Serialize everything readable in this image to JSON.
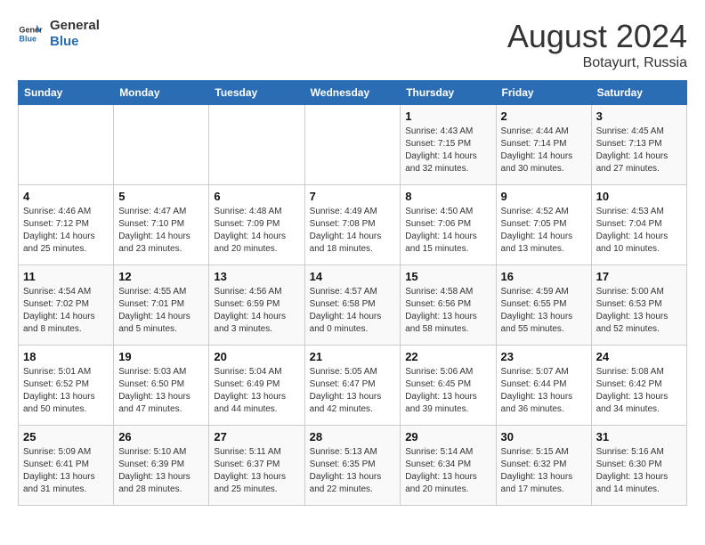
{
  "header": {
    "logo_line1": "General",
    "logo_line2": "Blue",
    "month_year": "August 2024",
    "location": "Botayurt, Russia"
  },
  "weekdays": [
    "Sunday",
    "Monday",
    "Tuesday",
    "Wednesday",
    "Thursday",
    "Friday",
    "Saturday"
  ],
  "weeks": [
    [
      {
        "day": "",
        "info": ""
      },
      {
        "day": "",
        "info": ""
      },
      {
        "day": "",
        "info": ""
      },
      {
        "day": "",
        "info": ""
      },
      {
        "day": "1",
        "info": "Sunrise: 4:43 AM\nSunset: 7:15 PM\nDaylight: 14 hours\nand 32 minutes."
      },
      {
        "day": "2",
        "info": "Sunrise: 4:44 AM\nSunset: 7:14 PM\nDaylight: 14 hours\nand 30 minutes."
      },
      {
        "day": "3",
        "info": "Sunrise: 4:45 AM\nSunset: 7:13 PM\nDaylight: 14 hours\nand 27 minutes."
      }
    ],
    [
      {
        "day": "4",
        "info": "Sunrise: 4:46 AM\nSunset: 7:12 PM\nDaylight: 14 hours\nand 25 minutes."
      },
      {
        "day": "5",
        "info": "Sunrise: 4:47 AM\nSunset: 7:10 PM\nDaylight: 14 hours\nand 23 minutes."
      },
      {
        "day": "6",
        "info": "Sunrise: 4:48 AM\nSunset: 7:09 PM\nDaylight: 14 hours\nand 20 minutes."
      },
      {
        "day": "7",
        "info": "Sunrise: 4:49 AM\nSunset: 7:08 PM\nDaylight: 14 hours\nand 18 minutes."
      },
      {
        "day": "8",
        "info": "Sunrise: 4:50 AM\nSunset: 7:06 PM\nDaylight: 14 hours\nand 15 minutes."
      },
      {
        "day": "9",
        "info": "Sunrise: 4:52 AM\nSunset: 7:05 PM\nDaylight: 14 hours\nand 13 minutes."
      },
      {
        "day": "10",
        "info": "Sunrise: 4:53 AM\nSunset: 7:04 PM\nDaylight: 14 hours\nand 10 minutes."
      }
    ],
    [
      {
        "day": "11",
        "info": "Sunrise: 4:54 AM\nSunset: 7:02 PM\nDaylight: 14 hours\nand 8 minutes."
      },
      {
        "day": "12",
        "info": "Sunrise: 4:55 AM\nSunset: 7:01 PM\nDaylight: 14 hours\nand 5 minutes."
      },
      {
        "day": "13",
        "info": "Sunrise: 4:56 AM\nSunset: 6:59 PM\nDaylight: 14 hours\nand 3 minutes."
      },
      {
        "day": "14",
        "info": "Sunrise: 4:57 AM\nSunset: 6:58 PM\nDaylight: 14 hours\nand 0 minutes."
      },
      {
        "day": "15",
        "info": "Sunrise: 4:58 AM\nSunset: 6:56 PM\nDaylight: 13 hours\nand 58 minutes."
      },
      {
        "day": "16",
        "info": "Sunrise: 4:59 AM\nSunset: 6:55 PM\nDaylight: 13 hours\nand 55 minutes."
      },
      {
        "day": "17",
        "info": "Sunrise: 5:00 AM\nSunset: 6:53 PM\nDaylight: 13 hours\nand 52 minutes."
      }
    ],
    [
      {
        "day": "18",
        "info": "Sunrise: 5:01 AM\nSunset: 6:52 PM\nDaylight: 13 hours\nand 50 minutes."
      },
      {
        "day": "19",
        "info": "Sunrise: 5:03 AM\nSunset: 6:50 PM\nDaylight: 13 hours\nand 47 minutes."
      },
      {
        "day": "20",
        "info": "Sunrise: 5:04 AM\nSunset: 6:49 PM\nDaylight: 13 hours\nand 44 minutes."
      },
      {
        "day": "21",
        "info": "Sunrise: 5:05 AM\nSunset: 6:47 PM\nDaylight: 13 hours\nand 42 minutes."
      },
      {
        "day": "22",
        "info": "Sunrise: 5:06 AM\nSunset: 6:45 PM\nDaylight: 13 hours\nand 39 minutes."
      },
      {
        "day": "23",
        "info": "Sunrise: 5:07 AM\nSunset: 6:44 PM\nDaylight: 13 hours\nand 36 minutes."
      },
      {
        "day": "24",
        "info": "Sunrise: 5:08 AM\nSunset: 6:42 PM\nDaylight: 13 hours\nand 34 minutes."
      }
    ],
    [
      {
        "day": "25",
        "info": "Sunrise: 5:09 AM\nSunset: 6:41 PM\nDaylight: 13 hours\nand 31 minutes."
      },
      {
        "day": "26",
        "info": "Sunrise: 5:10 AM\nSunset: 6:39 PM\nDaylight: 13 hours\nand 28 minutes."
      },
      {
        "day": "27",
        "info": "Sunrise: 5:11 AM\nSunset: 6:37 PM\nDaylight: 13 hours\nand 25 minutes."
      },
      {
        "day": "28",
        "info": "Sunrise: 5:13 AM\nSunset: 6:35 PM\nDaylight: 13 hours\nand 22 minutes."
      },
      {
        "day": "29",
        "info": "Sunrise: 5:14 AM\nSunset: 6:34 PM\nDaylight: 13 hours\nand 20 minutes."
      },
      {
        "day": "30",
        "info": "Sunrise: 5:15 AM\nSunset: 6:32 PM\nDaylight: 13 hours\nand 17 minutes."
      },
      {
        "day": "31",
        "info": "Sunrise: 5:16 AM\nSunset: 6:30 PM\nDaylight: 13 hours\nand 14 minutes."
      }
    ]
  ]
}
